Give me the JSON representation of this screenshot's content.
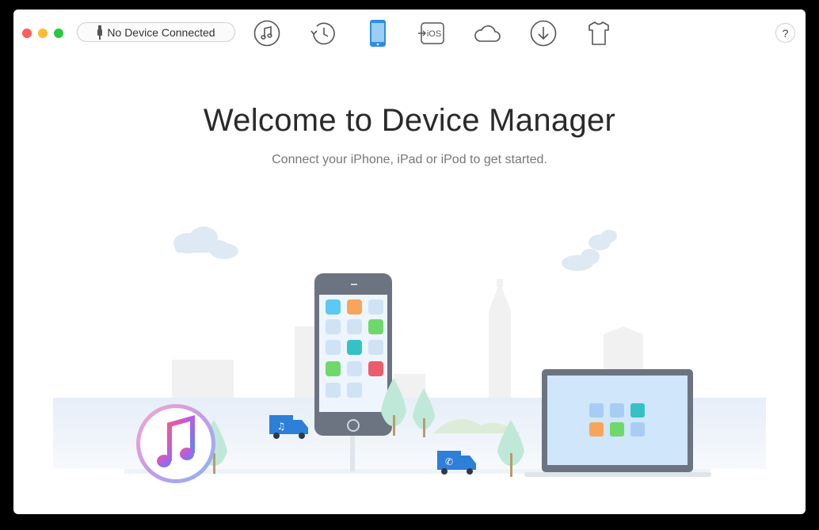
{
  "toolbar": {
    "device_status": "No Device Connected",
    "help_label": "?",
    "ios_label": "iOS",
    "icons": [
      "music-icon",
      "history-icon",
      "device-icon",
      "to-ios-icon",
      "cloud-icon",
      "download-icon",
      "tshirt-icon"
    ],
    "active_icon": "device-icon",
    "accent_color": "#2d8de2"
  },
  "main": {
    "title": "Welcome to Device Manager",
    "subtitle": "Connect your iPhone, iPad or iPod to get started."
  }
}
